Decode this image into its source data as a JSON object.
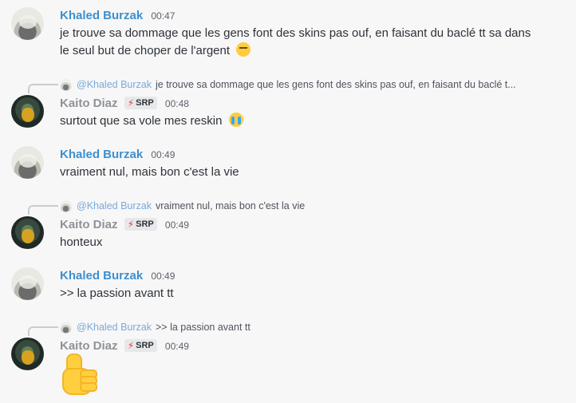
{
  "messages": [
    {
      "user": "Khaled Burzak",
      "time": "00:47",
      "text_line1": "je trouve sa dommage que les gens font des skins pas ouf, en faisant du baclé tt sa dans",
      "text_line2": "le seul but de choper de l'argent"
    },
    {
      "reply_mention": "@Khaled Burzak",
      "reply_text": "je trouve sa dommage que les gens font des skins pas ouf, en faisant du baclé t...",
      "user": "Kaito Diaz",
      "badge": "SRP",
      "time": "00:48",
      "text": "surtout que sa vole mes reskin"
    },
    {
      "user": "Khaled Burzak",
      "time": "00:49",
      "text": "vraiment nul, mais bon c'est la vie"
    },
    {
      "reply_mention": "@Khaled Burzak",
      "reply_text": "vraiment nul, mais bon c'est la vie",
      "user": "Kaito Diaz",
      "badge": "SRP",
      "time": "00:49",
      "text": "honteux"
    },
    {
      "user": "Khaled Burzak",
      "time": "00:49",
      "text": ">> la passion avant tt"
    },
    {
      "reply_mention": "@Khaled Burzak",
      "reply_text": ">> la passion avant tt",
      "user": "Kaito Diaz",
      "badge": "SRP",
      "time": "00:49"
    }
  ],
  "icons": {
    "pensive": "pensive-face-icon",
    "cry": "loudly-crying-face-icon",
    "thumbs": "thumbs-up-icon",
    "bolt": "lightning-icon"
  },
  "colors": {
    "khaled_name": "#3c8fcf",
    "kaito_name": "#8f9398",
    "mention": "#7aa9d8",
    "background": "#f7f7f8"
  }
}
